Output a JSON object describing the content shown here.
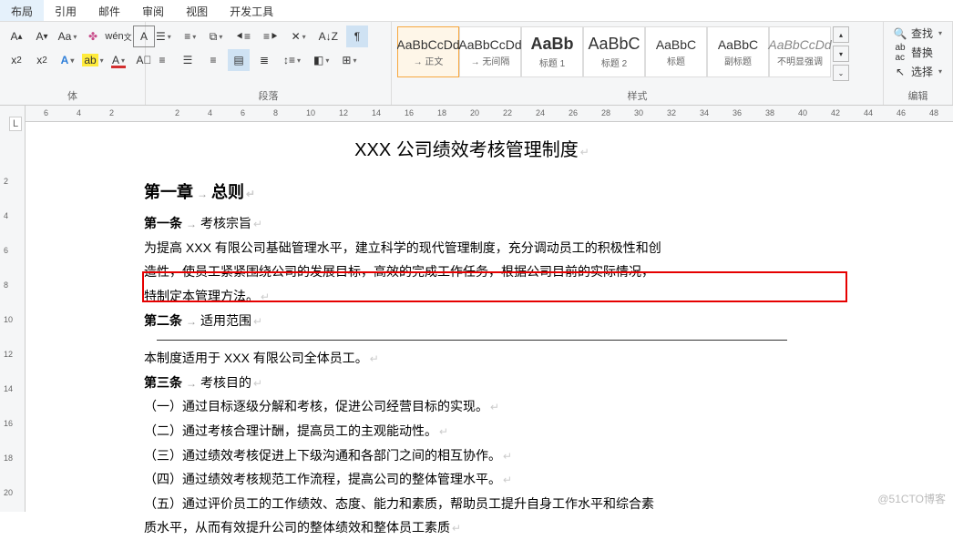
{
  "menu": [
    "布局",
    "引用",
    "邮件",
    "审阅",
    "视图",
    "开发工具"
  ],
  "ribbon": {
    "groups": {
      "font": "体",
      "paragraph": "段落",
      "styles": "样式",
      "editing": "编辑"
    }
  },
  "styles": [
    {
      "preview": "AaBbCcDd",
      "name": "→ 正文",
      "cls": ""
    },
    {
      "preview": "AaBbCcDd",
      "name": "→ 无间隔",
      "cls": ""
    },
    {
      "preview": "AaBb",
      "name": "标题 1",
      "cls": "large"
    },
    {
      "preview": "AaBbC",
      "name": "标题 2",
      "cls": "large"
    },
    {
      "preview": "AaBbC",
      "name": "标题",
      "cls": ""
    },
    {
      "preview": "AaBbC",
      "name": "副标题",
      "cls": ""
    },
    {
      "preview": "AaBbCcDd",
      "name": "不明显强调",
      "cls": "italic"
    }
  ],
  "editing": {
    "find": "查找",
    "replace": "替换",
    "select": "选择"
  },
  "hruler": [
    "6",
    "4",
    "2",
    "",
    "2",
    "4",
    "6",
    "8",
    "10",
    "12",
    "14",
    "16",
    "18",
    "20",
    "22",
    "24",
    "26",
    "28",
    "30",
    "32",
    "34",
    "36",
    "38",
    "40",
    "42",
    "44",
    "46",
    "48"
  ],
  "vruler": [
    "",
    "2",
    "4",
    "6",
    "8",
    "10",
    "12",
    "14",
    "16",
    "18",
    "20"
  ],
  "doc": {
    "title": "XXX 公司绩效考核管理制度",
    "chapter1": {
      "label": "第一章",
      "name": "总则"
    },
    "article1": {
      "label": "第一条",
      "name": "考核宗旨"
    },
    "p1a": "为提高 XXX 有限公司基础管理水平，建立科学的现代管理制度，充分调动员工的积极性和创",
    "p1b": "造性，使员工紧紧围绕公司的发展目标，高效的完成工作任务，根据公司目前的实际情况，",
    "p1c": "特制定本管理方法。",
    "article2": {
      "label": "第二条",
      "name": "适用范围"
    },
    "p2": "本制度适用于 XXX 有限公司全体员工。",
    "article3": {
      "label": "第三条",
      "name": "考核目的"
    },
    "i1": "（一）通过目标逐级分解和考核，促进公司经营目标的实现。",
    "i2": "（二）通过考核合理计酬，提高员工的主观能动性。",
    "i3": "（三）通过绩效考核促进上下级沟通和各部门之间的相互协作。",
    "i4": "（四）通过绩效考核规范工作流程，提高公司的整体管理水平。",
    "i5a": "（五）通过评价员工的工作绩效、态度、能力和素质，帮助员工提升自身工作水平和综合素",
    "i5b": "质水平，从而有效提升公司的整体绩效和整体员工素质"
  },
  "watermark": "@51CTO博客"
}
